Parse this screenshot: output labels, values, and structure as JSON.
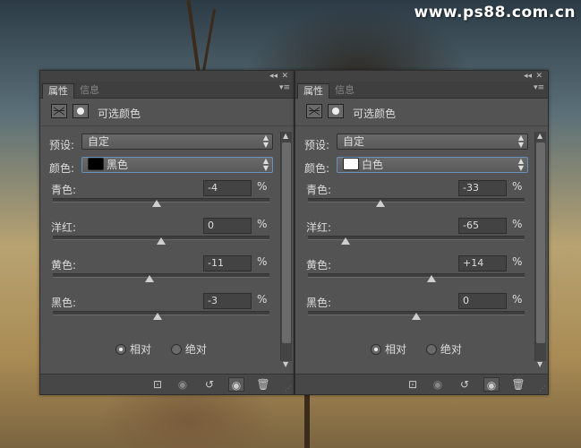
{
  "watermark": "www.ps88.com.cn",
  "panels": [
    {
      "tabs": [
        "属性",
        "信息"
      ],
      "title": "可选颜色",
      "preset_label": "预设:",
      "preset_value": "自定",
      "colors_label": "颜色:",
      "colors_value": "黑色",
      "swatch_color": "#000000",
      "sliders": [
        {
          "label": "青色:",
          "value": "-4",
          "unit": "%",
          "position": 0.48
        },
        {
          "label": "洋红:",
          "value": "0",
          "unit": "%",
          "position": 0.5
        },
        {
          "label": "黄色:",
          "value": "-11",
          "unit": "%",
          "position": 0.445
        },
        {
          "label": "黑色:",
          "value": "-3",
          "unit": "%",
          "position": 0.485
        }
      ],
      "method_relative": "相对",
      "method_absolute": "绝对"
    },
    {
      "tabs": [
        "属性",
        "信息"
      ],
      "title": "可选颜色",
      "preset_label": "预设:",
      "preset_value": "自定",
      "colors_label": "颜色:",
      "colors_value": "白色",
      "swatch_color": "#ffffff",
      "sliders": [
        {
          "label": "青色:",
          "value": "-33",
          "unit": "%",
          "position": 0.335
        },
        {
          "label": "洋红:",
          "value": "-65",
          "unit": "%",
          "position": 0.175
        },
        {
          "label": "黄色:",
          "value": "+14",
          "unit": "%",
          "position": 0.57
        },
        {
          "label": "黑色:",
          "value": "0",
          "unit": "%",
          "position": 0.5
        }
      ],
      "method_relative": "相对",
      "method_absolute": "绝对"
    }
  ]
}
